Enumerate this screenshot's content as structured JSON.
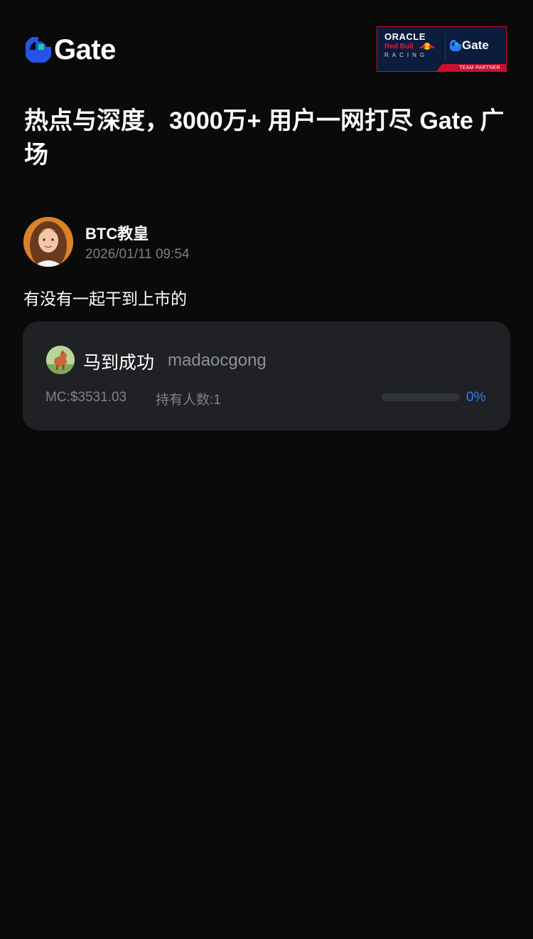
{
  "header": {
    "logo_text": "Gate",
    "partner": {
      "oracle": "ORACLE",
      "redbull": "Red Bull",
      "racing": "RACING",
      "gate": "Gate",
      "footer": "TEAM PARTNER"
    }
  },
  "headline": "热点与深度，3000万+ 用户一网打尽 Gate 广场",
  "post": {
    "author": "BTC教皇",
    "time": "2026/01/11 09:54",
    "text": "有没有一起干到上市的",
    "token": {
      "name": "马到成功",
      "ticker": "madaocgong",
      "market_cap": "MC:$3531.03",
      "holders": "持有人数:1",
      "progress_percent": 0,
      "progress_label": "0%"
    }
  },
  "colors": {
    "background": "#0a0a0b",
    "card": "#1f2124",
    "accent": "#2f7bf5",
    "muted": "#7b7e85",
    "brand_blue": "#2354e6",
    "brand_green": "#1fd08a"
  },
  "icons": {
    "logo_mark": "gate-logo-icon",
    "author_avatar": "user-avatar",
    "token_avatar": "token-avatar"
  }
}
